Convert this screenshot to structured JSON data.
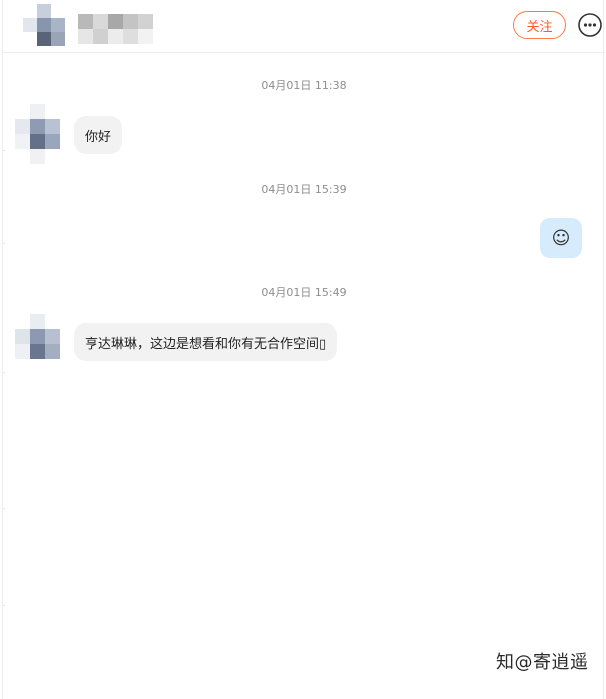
{
  "header": {
    "follow_label": "关注",
    "more_icon": "more-icon"
  },
  "messages": [
    {
      "type": "timestamp",
      "text": "04月01日 11:38"
    },
    {
      "type": "incoming",
      "text": "你好"
    },
    {
      "type": "timestamp",
      "text": "04月01日 15:39"
    },
    {
      "type": "outgoing",
      "text": "☺"
    },
    {
      "type": "timestamp",
      "text": "04月01日 15:49"
    },
    {
      "type": "incoming",
      "text": "亨达琳琳，这边是想看和你有无合作空间▯"
    }
  ],
  "watermark": "知@寄逍遥",
  "colors": {
    "follow_border": "#ff7a45",
    "incoming_bubble": "#f2f2f2",
    "outgoing_bubble": "#d6ebfb"
  }
}
